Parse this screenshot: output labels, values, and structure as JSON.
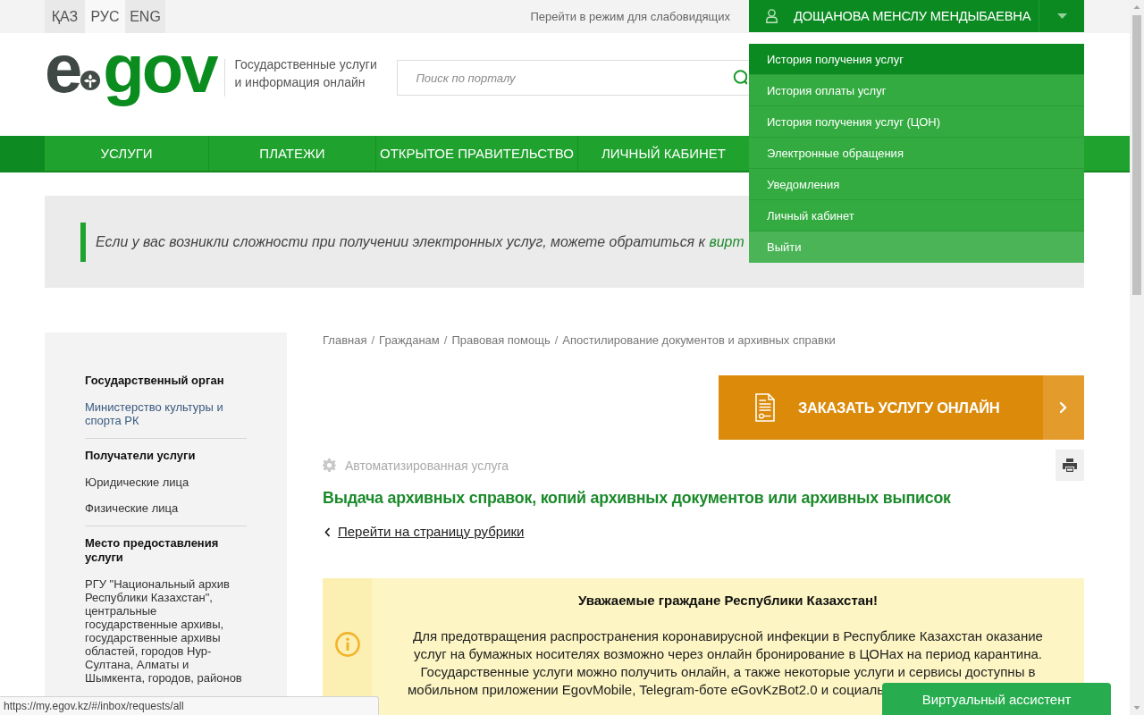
{
  "top_bar": {
    "languages": [
      {
        "label": "ҚАЗ",
        "selected": false
      },
      {
        "label": "РУС",
        "selected": true
      },
      {
        "label": "ENG",
        "selected": false
      }
    ],
    "accessibility_link": "Перейти в режим для слабовидящих",
    "user": {
      "name": "ДОЩАНОВА МЕНСЛУ МЕНДЫБАЕВНА",
      "expanded": true
    }
  },
  "header": {
    "logo": {
      "part_1": "e",
      "part_2": "gov"
    },
    "tagline": "Государственные услуги и информация онлайн",
    "search": {
      "placeholder": "Поиск по порталу"
    }
  },
  "nav": [
    {
      "label": "УСЛУГИ"
    },
    {
      "label": "ПЛАТЕЖИ"
    },
    {
      "label": "ОТКРЫТОЕ ПРАВИТЕЛЬСТВО"
    },
    {
      "label": "ЛИЧНЫЙ КАБИНЕТ"
    }
  ],
  "user_menu": [
    {
      "label": "История получения услуг",
      "selected": true,
      "kind": "link"
    },
    {
      "label": "История оплаты услуг",
      "selected": false,
      "kind": "link"
    },
    {
      "label": "История получения услуг (ЦОН)",
      "selected": false,
      "kind": "link"
    },
    {
      "label": "Электронные обращения",
      "selected": false,
      "kind": "link"
    },
    {
      "label": "Уведомления",
      "selected": false,
      "kind": "link"
    },
    {
      "label": "Личный кабинет",
      "selected": false,
      "kind": "link"
    },
    {
      "label": "Выйти",
      "selected": false,
      "kind": "exit"
    }
  ],
  "banner": {
    "text": "Если у вас возникли сложности при получении электронных услуг, можете обратиться к",
    "link": "вирт"
  },
  "sidebar": {
    "sections": [
      {
        "heading": "Государственный орган",
        "items": [
          {
            "text": "Министерство культуры и спорта РК",
            "kind": "link"
          }
        ]
      },
      {
        "heading": "Получатели услуги",
        "items": [
          {
            "text": "Юридические лица",
            "kind": "text"
          },
          {
            "text": "Физические лица",
            "kind": "text"
          }
        ]
      },
      {
        "heading": "Место предоставления услуги",
        "items": [
          {
            "text": "РГУ \"Национальный архив Республики Казахстан\", центральные государственные архивы, государственные архивы областей, городов Нур-Султана, Алматы и Шымкента, городов, районов",
            "kind": "text"
          }
        ]
      }
    ]
  },
  "breadcrumb": [
    {
      "label": "Главная",
      "separator": "/"
    },
    {
      "label": "Гражданам",
      "separator": "/"
    },
    {
      "label": "Правовая помощь",
      "separator": "/"
    },
    {
      "label": "Апостилирование документов и архивных справки"
    }
  ],
  "order_button": {
    "label": "ЗАКАЗАТЬ УСЛУГУ ОНЛАЙН"
  },
  "service_type": "Автоматизированная услуга",
  "title": "Выдача архивных справок, копий архивных документов или архивных выписок",
  "back_link": "Перейти на страницу рубрики",
  "notice": {
    "title": "Уважаемые граждане Республики Казахстан!",
    "paragraphs": [
      "Для предотвращения распространения коронавирусной инфекции в Республике Казахстан оказание услуг на бумажных носителях возможно через онлайн бронирование в ЦОНах на период карантина.",
      "Государственные услуги можно получить онлайн, а также некоторые услуги и сервисы доступны в мобильном приложении EgovMobile, Telegram-боте eGovKzBot2.0 и социаль"
    ]
  },
  "status_url": "https://my.egov.kz/#/inbox/requests/all",
  "assistant_button": {
    "label": "Виртуальный ассистент"
  }
}
